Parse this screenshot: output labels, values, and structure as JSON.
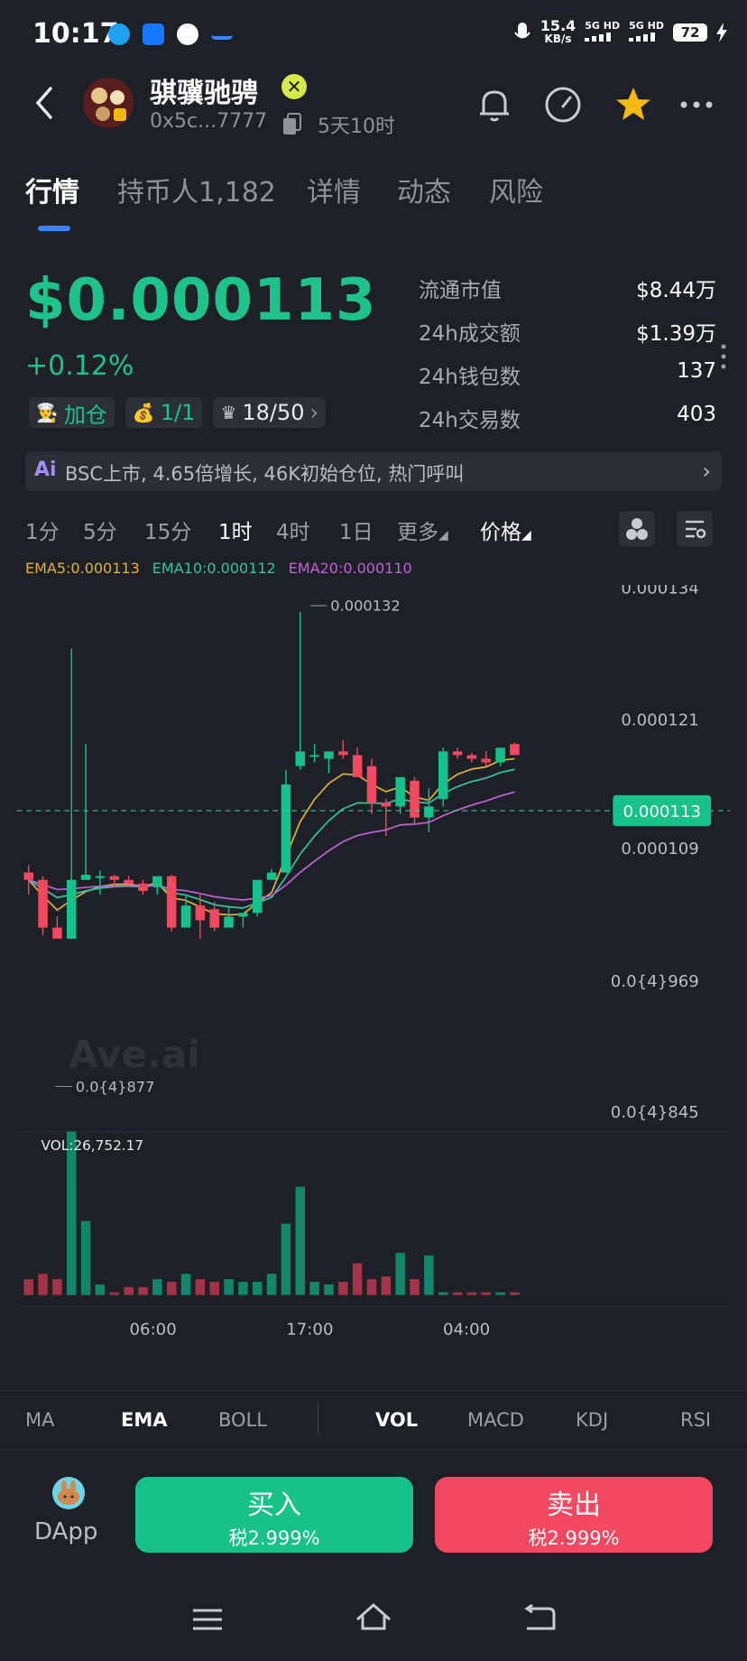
{
  "status_bar": {
    "time": "10:17",
    "net_speed": "15.4",
    "net_unit": "KB/s",
    "sim1": "5G HD",
    "sim2": "5G HD",
    "battery": "72"
  },
  "header": {
    "token_name": "骐骥驰骋",
    "address": "0x5c...7777",
    "age": "5天10时"
  },
  "tabs": [
    "行情",
    "持币人1,182",
    "详情",
    "动态",
    "风险"
  ],
  "price": {
    "value": "$0.000113",
    "change": "+0.12%"
  },
  "chips": {
    "add_position": "加仓",
    "ratio": "1/1",
    "rank": "18/50"
  },
  "stats": [
    {
      "label": "流通市值",
      "value": "$8.44万"
    },
    {
      "label": "24h成交额",
      "value": "$1.39万"
    },
    {
      "label": "24h钱包数",
      "value": "137"
    },
    {
      "label": "24h交易数",
      "value": "403"
    }
  ],
  "ai_banner": {
    "tag": "Ai",
    "text": "BSC上市, 4.65倍增长, 46K初始仓位, 热门呼叫"
  },
  "intervals": [
    "1分",
    "5分",
    "15分",
    "1时",
    "4时",
    "1日",
    "更多",
    "价格"
  ],
  "ema_legend": [
    {
      "label": "EMA5:0.000113",
      "color": "#e0b23a"
    },
    {
      "label": "EMA10:0.000112",
      "color": "#35c4a0"
    },
    {
      "label": "EMA20:0.000110",
      "color": "#c062d6"
    }
  ],
  "chart_data": {
    "type": "candlestick",
    "y_axis_labels": [
      "0.000134",
      "0.000121",
      "0.000109",
      "0.0{4}969",
      "0.0{4}845"
    ],
    "current_price_label": "0.000113",
    "high_annotation": "0.000132",
    "low_annotation": "0.0{4}877",
    "x_axis_labels": [
      "06:00",
      "17:00",
      "04:00"
    ],
    "watermark": "Ave.ai",
    "volume_label": "VOL:26,752.17",
    "candles": [
      {
        "o": 9.65e-05,
        "h": 9.75e-05,
        "l": 9.35e-05,
        "c": 9.55e-05
      },
      {
        "o": 9.55e-05,
        "h": 9.6e-05,
        "l": 8.8e-05,
        "c": 8.9e-05
      },
      {
        "o": 8.9e-05,
        "h": 9.05e-05,
        "l": 8.8e-05,
        "c": 8.75e-05
      },
      {
        "o": 8.75e-05,
        "h": 0.000127,
        "l": 8.75e-05,
        "c": 9.55e-05
      },
      {
        "o": 9.55e-05,
        "h": 0.000114,
        "l": 9.6e-05,
        "c": 9.62e-05
      },
      {
        "o": 9.6e-05,
        "h": 9.68e-05,
        "l": 9.35e-05,
        "c": 9.6e-05
      },
      {
        "o": 9.6e-05,
        "h": 9.62e-05,
        "l": 9.45e-05,
        "c": 9.55e-05
      },
      {
        "o": 9.55e-05,
        "h": 9.6e-05,
        "l": 9.45e-05,
        "c": 9.5e-05
      },
      {
        "o": 9.5e-05,
        "h": 9.55e-05,
        "l": 9.35e-05,
        "c": 9.4e-05
      },
      {
        "o": 9.45e-05,
        "h": 9.6e-05,
        "l": 9.35e-05,
        "c": 9.6e-05
      },
      {
        "o": 9.6e-05,
        "h": 9.62e-05,
        "l": 8.85e-05,
        "c": 8.9e-05
      },
      {
        "o": 8.9e-05,
        "h": 9.35e-05,
        "l": 8.95e-05,
        "c": 9.2e-05
      },
      {
        "o": 9.2e-05,
        "h": 9.35e-05,
        "l": 8.75e-05,
        "c": 9e-05
      },
      {
        "o": 9.15e-05,
        "h": 9.25e-05,
        "l": 8.85e-05,
        "c": 8.9e-05
      },
      {
        "o": 8.9e-05,
        "h": 9.2e-05,
        "l": 8.9e-05,
        "c": 9.05e-05
      },
      {
        "o": 9.05e-05,
        "h": 9.1e-05,
        "l": 8.9e-05,
        "c": 9.1e-05
      },
      {
        "o": 9.1e-05,
        "h": 9.55e-05,
        "l": 9.05e-05,
        "c": 9.55e-05
      },
      {
        "o": 9.55e-05,
        "h": 9.7e-05,
        "l": 9.55e-05,
        "c": 9.65e-05
      },
      {
        "o": 9.65e-05,
        "h": 0.0001105,
        "l": 9.65e-05,
        "c": 0.0001085
      },
      {
        "o": 0.000111,
        "h": 0.000132,
        "l": 0.0001105,
        "c": 0.000113
      },
      {
        "o": 0.0001125,
        "h": 0.000114,
        "l": 0.0001115,
        "c": 0.0001125
      },
      {
        "o": 0.000112,
        "h": 0.0001125,
        "l": 0.00011,
        "c": 0.000113
      },
      {
        "o": 0.000113,
        "h": 0.0001145,
        "l": 0.000112,
        "c": 0.0001125
      },
      {
        "o": 0.0001125,
        "h": 0.0001135,
        "l": 0.0001105,
        "c": 0.0001095
      },
      {
        "o": 0.000111,
        "h": 0.000112,
        "l": 0.0001045,
        "c": 0.000106
      },
      {
        "o": 0.000106,
        "h": 0.0001065,
        "l": 0.0001015,
        "c": 0.0001055
      },
      {
        "o": 0.0001055,
        "h": 0.000109,
        "l": 0.0001045,
        "c": 0.0001095
      },
      {
        "o": 0.000109,
        "h": 0.0001095,
        "l": 0.000103,
        "c": 0.000104
      },
      {
        "o": 0.000104,
        "h": 0.000108,
        "l": 0.000102,
        "c": 0.0001055
      },
      {
        "o": 0.0001065,
        "h": 0.0001135,
        "l": 0.0001055,
        "c": 0.000113
      },
      {
        "o": 0.000113,
        "h": 0.0001135,
        "l": 0.000112,
        "c": 0.0001125
      },
      {
        "o": 0.0001125,
        "h": 0.0001128,
        "l": 0.0001115,
        "c": 0.000112
      },
      {
        "o": 0.000112,
        "h": 0.000113,
        "l": 0.000111,
        "c": 0.0001115
      },
      {
        "o": 0.0001115,
        "h": 0.0001135,
        "l": 0.000111,
        "c": 0.0001135
      },
      {
        "o": 0.000114,
        "h": 0.0001142,
        "l": 0.0001125,
        "c": 0.0001125
      }
    ],
    "volumes": [
      0.06,
      0.08,
      0.06,
      0.62,
      0.28,
      0.04,
      0.01,
      0.03,
      0.03,
      0.06,
      0.05,
      0.08,
      0.06,
      0.05,
      0.06,
      0.05,
      0.05,
      0.08,
      0.27,
      0.41,
      0.05,
      0.04,
      0.05,
      0.12,
      0.06,
      0.07,
      0.16,
      0.06,
      0.15,
      0.01,
      0.01,
      0.01,
      0.01,
      0.01,
      0.01
    ]
  },
  "indicator_tabs": [
    "MA",
    "EMA",
    "BOLL",
    "VOL",
    "MACD",
    "KDJ",
    "RSI"
  ],
  "actions": {
    "dapp_label": "DApp",
    "buy_label": "买入",
    "buy_tax": "税2.999%",
    "sell_label": "卖出",
    "sell_tax": "税2.999%"
  },
  "colors": {
    "up": "#16c18a",
    "down": "#f24860",
    "accent": "#3b82f6"
  }
}
